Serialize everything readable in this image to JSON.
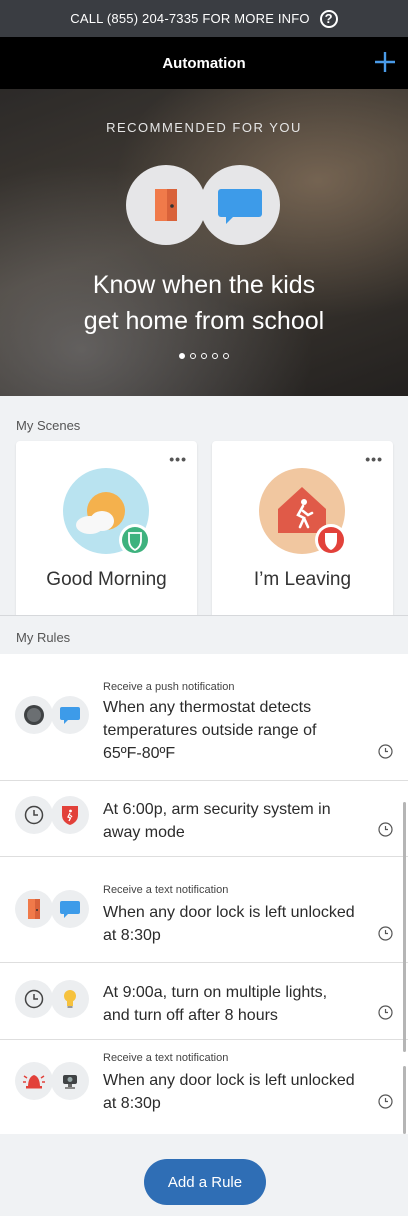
{
  "banner": {
    "text": "CALL (855) 204-7335 FOR MORE INFO",
    "help_icon": "?"
  },
  "nav": {
    "title": "Automation",
    "add_icon": "plus-icon"
  },
  "hero": {
    "eyebrow": "RECOMMENDED FOR YOU",
    "headline_line1": "Know when the kids",
    "headline_line2": "get home from school",
    "page_count": 5,
    "active_page": 1
  },
  "scenes": {
    "label": "My Scenes",
    "items": [
      {
        "name": "Good Morning",
        "menu": "•••"
      },
      {
        "name": "I’m Leaving",
        "menu": "•••"
      }
    ]
  },
  "rules": {
    "label": "My Rules",
    "items": [
      {
        "subtitle": "Receive a push notification",
        "line1": "When any thermostat detects",
        "line2": "temperatures outside range of",
        "line3": "65ºF-80ºF"
      },
      {
        "subtitle": "",
        "line1": "At 6:00p, arm security system in",
        "line2": "away mode",
        "line3": ""
      },
      {
        "subtitle": "Receive a text notification",
        "line1": "When any door lock is left unlocked",
        "line2": "at 8:30p",
        "line3": ""
      },
      {
        "subtitle": "",
        "line1": "At 9:00a, turn on multiple lights,",
        "line2": "and turn off after 8 hours",
        "line3": ""
      },
      {
        "subtitle": "Receive a text notification",
        "line1": "When any door lock is left unlocked",
        "line2": "at 8:30p",
        "line3": ""
      }
    ]
  },
  "footer": {
    "add_rule": "Add a Rule"
  },
  "colors": {
    "accent": "#2f6eb5",
    "navbar": "#000000",
    "banner": "#3a3d42",
    "alert_red": "#e2413a",
    "chat_blue": "#3d9be9",
    "door_orange": "#f07a4a"
  }
}
